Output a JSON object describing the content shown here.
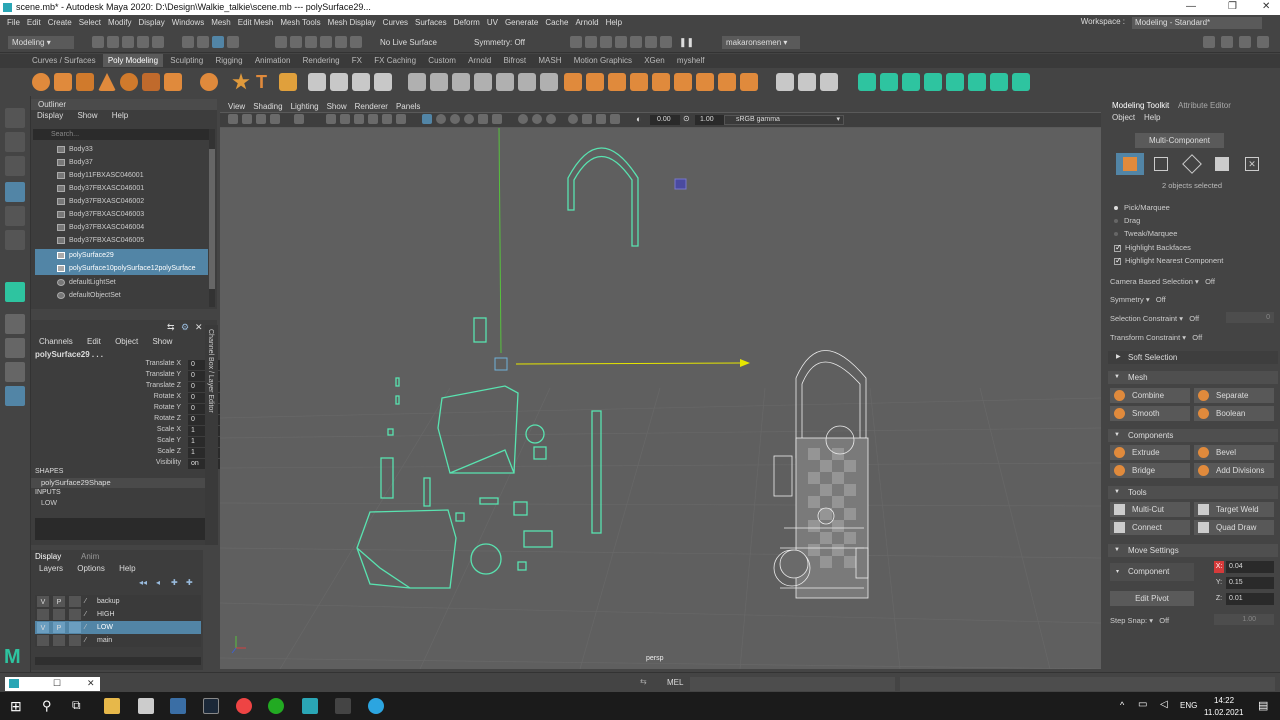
{
  "title_bar": {
    "text": "scene.mb* - Autodesk Maya 2020: D:\\Design\\Walkie_talkie\\scene.mb   ---   polySurface29..."
  },
  "menu": [
    "File",
    "Edit",
    "Create",
    "Select",
    "Modify",
    "Display",
    "Windows",
    "Mesh",
    "Edit Mesh",
    "Mesh Tools",
    "Mesh Display",
    "Curves",
    "Surfaces",
    "Deform",
    "UV",
    "Generate",
    "Cache",
    "Arnold",
    "Help"
  ],
  "workspace": {
    "label": "Workspace :",
    "value": "Modeling - Standard*"
  },
  "status_line": {
    "mode": "Modeling",
    "live_surface": "No Live Surface",
    "symmetry": "Symmetry: Off",
    "user": "makaronsemen"
  },
  "shelf_tabs": [
    "Curves / Surfaces",
    "Poly Modeling",
    "Sculpting",
    "Rigging",
    "Animation",
    "Rendering",
    "FX",
    "FX Caching",
    "Custom",
    "Arnold",
    "Bifrost",
    "MASH",
    "Motion Graphics",
    "XGen",
    "myshelf"
  ],
  "shelf_active": "Poly Modeling",
  "outliner": {
    "title": "Outliner",
    "menu": [
      "Display",
      "Show",
      "Help"
    ],
    "search_placeholder": "Search...",
    "items": [
      {
        "name": "Body33",
        "selected": false
      },
      {
        "name": "Body37",
        "selected": false
      },
      {
        "name": "Body11FBXASC046001",
        "selected": false
      },
      {
        "name": "Body37FBXASC046001",
        "selected": false
      },
      {
        "name": "Body37FBXASC046002",
        "selected": false
      },
      {
        "name": "Body37FBXASC046003",
        "selected": false
      },
      {
        "name": "Body37FBXASC046004",
        "selected": false
      },
      {
        "name": "Body37FBXASC046005",
        "selected": false
      },
      {
        "name": "polySurface29",
        "selected": true
      },
      {
        "name": "polySurface10polySurface12polySurface",
        "selected": true
      },
      {
        "name": "defaultLightSet",
        "selected": false
      },
      {
        "name": "defaultObjectSet",
        "selected": false
      }
    ]
  },
  "channel_box": {
    "menu": [
      "Channels",
      "Edit",
      "Object",
      "Show"
    ],
    "object": "polySurface29 . . .",
    "attrs": [
      {
        "label": "Translate X",
        "value": "0"
      },
      {
        "label": "Translate Y",
        "value": "0"
      },
      {
        "label": "Translate Z",
        "value": "0"
      },
      {
        "label": "Rotate X",
        "value": "0"
      },
      {
        "label": "Rotate Y",
        "value": "0"
      },
      {
        "label": "Rotate Z",
        "value": "0"
      },
      {
        "label": "Scale X",
        "value": "1"
      },
      {
        "label": "Scale Y",
        "value": "1"
      },
      {
        "label": "Scale Z",
        "value": "1"
      },
      {
        "label": "Visibility",
        "value": "on"
      }
    ],
    "shapes_label": "SHAPES",
    "shape": "polySurface29Shape",
    "inputs_label": "INPUTS",
    "input": "LOW",
    "side_tab": "Channel Box / Layer Editor"
  },
  "layers": {
    "tabs": [
      "Display",
      "Anim"
    ],
    "menu": [
      "Layers",
      "Options",
      "Help"
    ],
    "rows": [
      {
        "v": "V",
        "p": "P",
        "name": "backup",
        "selected": false
      },
      {
        "v": "",
        "p": "",
        "name": "HIGH",
        "selected": false
      },
      {
        "v": "V",
        "p": "P",
        "name": "LOW",
        "selected": true
      },
      {
        "v": "",
        "p": "",
        "name": "main",
        "selected": false
      }
    ]
  },
  "viewport": {
    "menu": [
      "View",
      "Shading",
      "Lighting",
      "Show",
      "Renderer",
      "Panels"
    ],
    "field1": "0.00",
    "field2": "1.00",
    "color_space": "sRGB gamma",
    "camera": "persp"
  },
  "toolkit": {
    "tabs": [
      "Modeling Toolkit",
      "Attribute Editor"
    ],
    "menu": [
      "Object",
      "Help"
    ],
    "mode": "Multi-Component",
    "selected_info": "2 objects selected",
    "options": [
      {
        "label": "Pick/Marquee",
        "type": "radio",
        "on": true
      },
      {
        "label": "Drag",
        "type": "radio",
        "on": false
      },
      {
        "label": "Tweak/Marquee",
        "type": "radio",
        "on": false
      },
      {
        "label": "Highlight Backfaces",
        "type": "check",
        "on": true
      },
      {
        "label": "Highlight Nearest Component",
        "type": "check",
        "on": true
      }
    ],
    "camera_based_selection": {
      "label": "Camera Based Selection",
      "value": "Off"
    },
    "symmetry": {
      "label": "Symmetry",
      "value": "Off"
    },
    "selection_constraint": {
      "label": "Selection Constraint",
      "value": "Off",
      "num": "0"
    },
    "transform_constraint": {
      "label": "Transform Constraint",
      "value": "Off"
    },
    "soft_selection": "Soft Selection",
    "mesh": {
      "header": "Mesh",
      "buttons": [
        "Combine",
        "Separate",
        "Smooth",
        "Boolean"
      ]
    },
    "components": {
      "header": "Components",
      "buttons": [
        "Extrude",
        "Bevel",
        "Bridge",
        "Add Divisions"
      ]
    },
    "tools": {
      "header": "Tools",
      "buttons": [
        "Multi-Cut",
        "Target Weld",
        "Connect",
        "Quad Draw"
      ]
    },
    "move_settings": {
      "header": "Move Settings",
      "mode": "Component",
      "x": "0.04",
      "y": "0.15",
      "z": "0.01",
      "edit_pivot": "Edit Pivot"
    },
    "step_snap": {
      "label": "Step Snap:",
      "value": "Off",
      "num": "1.00"
    }
  },
  "command_line": {
    "lang": "MEL"
  },
  "taskbar": {
    "time": "14:22",
    "date": "11.02.2021",
    "lang": "ENG"
  }
}
